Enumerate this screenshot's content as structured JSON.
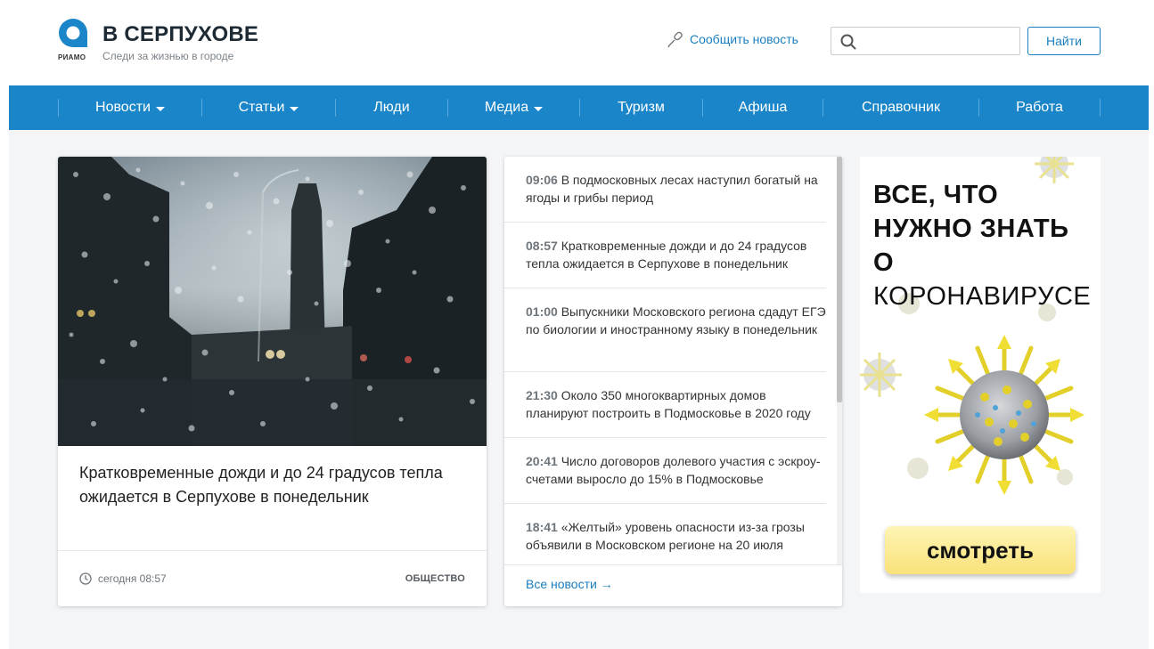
{
  "header": {
    "logo_caption": "РИАМО",
    "title": "В СЕРПУХОВЕ",
    "tagline": "Следи за жизнью в городе",
    "report_link": "Сообщить новость",
    "search_placeholder": "",
    "search_button": "Найти"
  },
  "nav": {
    "items": [
      {
        "label": "Новости",
        "dropdown": true
      },
      {
        "label": "Статьи",
        "dropdown": true
      },
      {
        "label": "Люди",
        "dropdown": false
      },
      {
        "label": "Медиа",
        "dropdown": true
      },
      {
        "label": "Туризм",
        "dropdown": false
      },
      {
        "label": "Афиша",
        "dropdown": false
      },
      {
        "label": "Справочник",
        "dropdown": false
      },
      {
        "label": "Работа",
        "dropdown": false
      }
    ]
  },
  "main_article": {
    "title": "Кратковременные дожди и до 24 градусов тепла ожидается в Серпухове в понедельник",
    "time": "сегодня 08:57",
    "rubric": "ОБЩЕСТВО"
  },
  "news_feed": {
    "items": [
      {
        "time": "09:06",
        "text": "В подмосковных лесах наступил богатый на ягоды и грибы период"
      },
      {
        "time": "08:57",
        "text": "Кратковременные дожди и до 24 градусов тепла ожидается в Серпухове в понедельник"
      },
      {
        "time": "01:00",
        "text": "Выпускники Московского региона сдадут ЕГЭ по биологии и иностранному языку в понедельник"
      },
      {
        "time": "21:30",
        "text": "Около 350 многоквартирных домов планируют построить в Подмосковье в 2020 году"
      },
      {
        "time": "20:41",
        "text": "Число договоров долевого участия с эскроу-счетами выросло до 15% в Подмосковье"
      },
      {
        "time": "18:41",
        "text": "«Желтый» уровень опасности из-за грозы объявили в Московском регионе на 20 июля"
      }
    ],
    "all_news": "Все новости →"
  },
  "banner": {
    "line1": "ВСЕ, ЧТО",
    "line2": "НУЖНО ЗНАТЬ",
    "line3_bold": "О",
    "line3_rest": "КОРОНАВИРУСЕ",
    "button": "смотреть"
  },
  "colors": {
    "nav_bg": "#1a86c9",
    "link": "#1a7fc0",
    "banner_button": "#f9e27a",
    "virus_spikes": "#e3cf2a"
  }
}
